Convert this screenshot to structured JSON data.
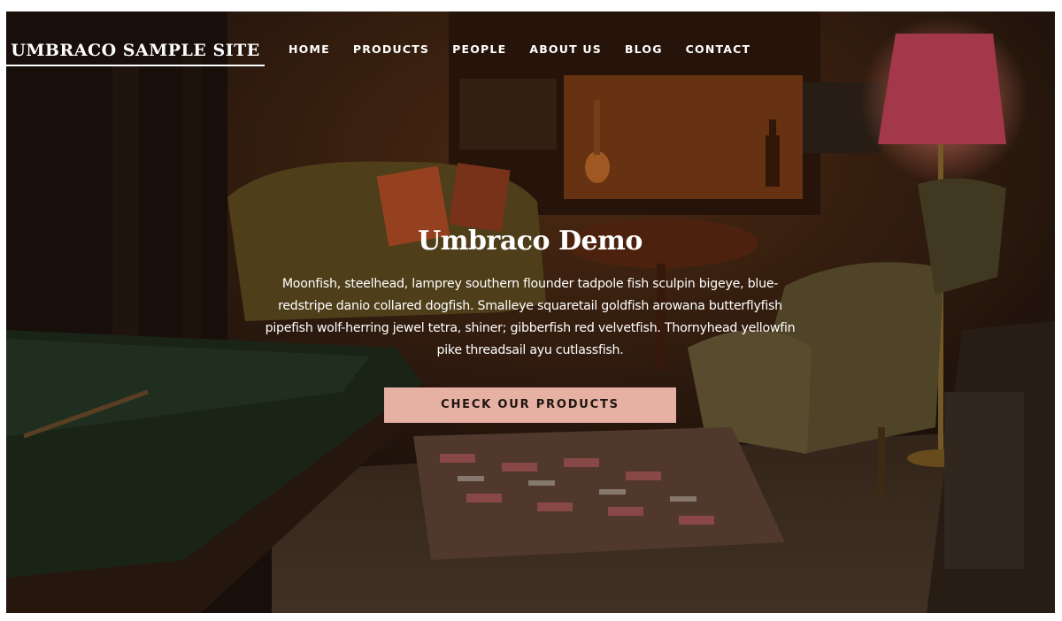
{
  "header": {
    "logo_text": "UMBRACO SAMPLE SITE",
    "nav": [
      {
        "label": "HOME"
      },
      {
        "label": "PRODUCTS"
      },
      {
        "label": "PEOPLE"
      },
      {
        "label": "ABOUT US"
      },
      {
        "label": "BLOG"
      },
      {
        "label": "CONTACT"
      }
    ]
  },
  "hero": {
    "title": "Umbraco Demo",
    "text": "Moonfish, steelhead, lamprey southern flounder tadpole fish sculpin bigeye, blue-redstripe danio collared dogfish. Smalleye squaretail goldfish arowana butterflyfish pipefish wolf-herring jewel tetra, shiner; gibberfish red velvetfish. Thornyhead yellowfin pike threadsail ayu cutlassfish.",
    "cta_label": "CHECK OUR PRODUCTS",
    "background_image": "dark lounge room with sofa, armchairs, lamp, pool table",
    "colors": {
      "cta_background": "#e6b0a3",
      "cta_text": "#1e1512",
      "text": "#ffffff"
    }
  }
}
